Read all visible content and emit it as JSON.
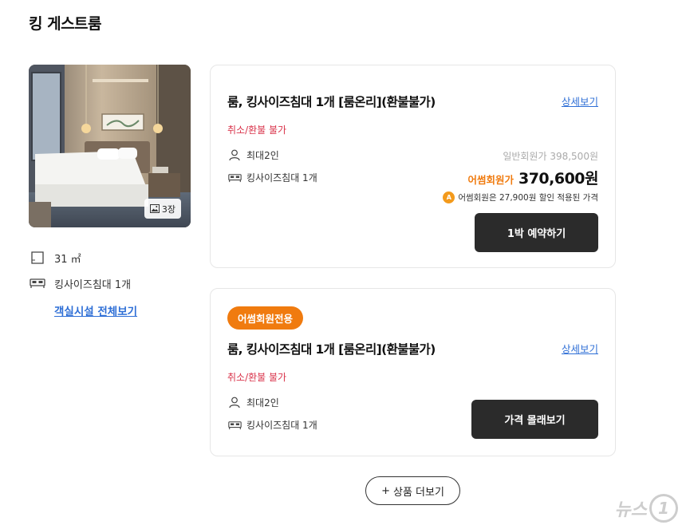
{
  "section": {
    "title": "킹 게스트룸"
  },
  "photo": {
    "count_label": "3장"
  },
  "room_info": {
    "area": "31 ㎡",
    "bed": "킹사이즈침대 1개",
    "facility_link": "객실시설 전체보기"
  },
  "offers": [
    {
      "title": "룸, 킹사이즈침대 1개 [룸온리](환불불가)",
      "detail_link": "상세보기",
      "cancel_policy": "취소/환불 불가",
      "occupancy": "최대2인",
      "bed": "킹사이즈침대 1개",
      "regular_price": "일반회원가 398,500원",
      "member_label": "어썸회원가",
      "member_price": "370,600원",
      "discount_badge": "A",
      "discount_note": "어썸회원은 27,900원 할인 적용된 가격",
      "button": "1박 예약하기"
    },
    {
      "badge": "어썸회원전용",
      "title": "룸, 킹사이즈침대 1개 [룸온리](환불불가)",
      "detail_link": "상세보기",
      "cancel_policy": "취소/환불 불가",
      "occupancy": "최대2인",
      "bed": "킹사이즈침대 1개",
      "button": "가격 몰래보기"
    }
  ],
  "more_button": {
    "plus": "+",
    "label": "상품 더보기"
  },
  "watermark": {
    "text": "뉴스",
    "mark": "1"
  },
  "colors": {
    "accent_orange": "#f07b0f",
    "cancel_red": "#d9334a",
    "link_blue": "#2f6fd6",
    "button_dark": "#2b2b2b"
  },
  "icons": {
    "photo_count": "image-icon",
    "area": "floor-area-icon",
    "bed": "bed-icon",
    "occupancy": "person-icon"
  }
}
